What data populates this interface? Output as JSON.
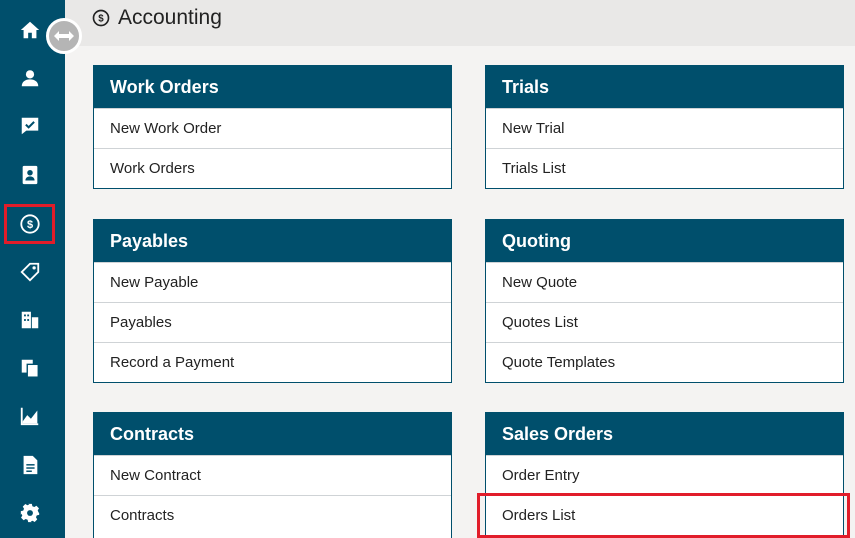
{
  "header": {
    "title": "Accounting",
    "icon": "dollar-circle-icon"
  },
  "sidebar": {
    "items": [
      {
        "name": "home",
        "icon": "home-icon"
      },
      {
        "name": "contacts",
        "icon": "user-icon"
      },
      {
        "name": "tasks",
        "icon": "chat-check-icon"
      },
      {
        "name": "address-book",
        "icon": "address-book-icon"
      },
      {
        "name": "accounting",
        "icon": "dollar-circle-icon",
        "active": true
      },
      {
        "name": "tags",
        "icon": "tags-icon"
      },
      {
        "name": "company",
        "icon": "building-icon"
      },
      {
        "name": "documents",
        "icon": "copy-icon"
      },
      {
        "name": "reports",
        "icon": "chart-icon"
      },
      {
        "name": "files",
        "icon": "file-icon"
      },
      {
        "name": "settings",
        "icon": "gear-icon"
      }
    ]
  },
  "cards": {
    "work_orders": {
      "title": "Work Orders",
      "items": [
        "New Work Order",
        "Work Orders"
      ]
    },
    "trials": {
      "title": "Trials",
      "items": [
        "New Trial",
        "Trials List"
      ]
    },
    "payables": {
      "title": "Payables",
      "items": [
        "New Payable",
        "Payables",
        "Record a Payment"
      ]
    },
    "quoting": {
      "title": "Quoting",
      "items": [
        "New Quote",
        "Quotes List",
        "Quote Templates"
      ]
    },
    "contracts": {
      "title": "Contracts",
      "items": [
        "New Contract",
        "Contracts"
      ]
    },
    "sales_orders": {
      "title": "Sales Orders",
      "items": [
        "Order Entry",
        "Orders List"
      ]
    }
  },
  "colors": {
    "brand": "#004f6c",
    "highlight": "#e11d2a",
    "background": "#f4f3f2"
  }
}
